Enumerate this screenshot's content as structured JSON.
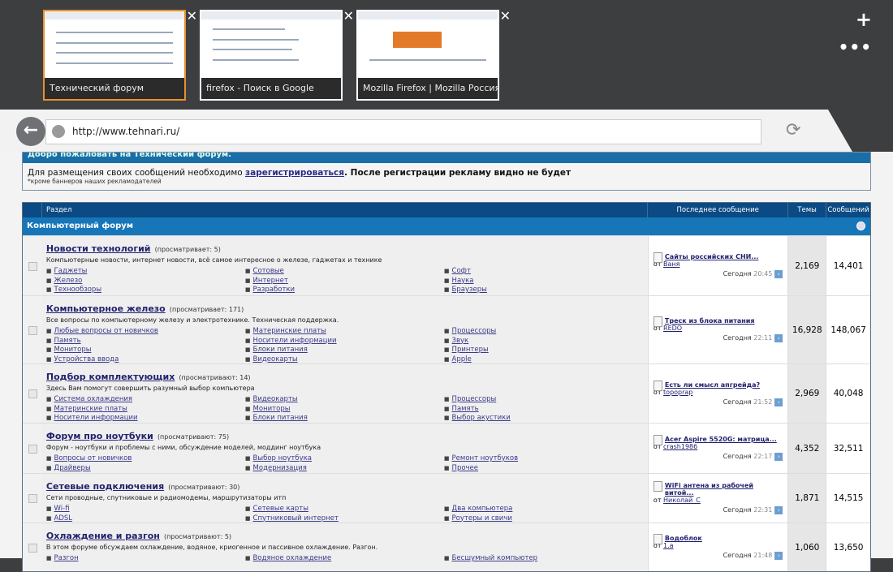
{
  "tabs": [
    {
      "label": "Технический форум",
      "active": true
    },
    {
      "label": "firefox - Поиск в Google"
    },
    {
      "label": "Mozilla Firefox | Mozilla Россия"
    }
  ],
  "browser": {
    "url": "http://www.tehnari.ru/",
    "new_tab": "+",
    "more": "•••"
  },
  "welcome": {
    "title": "Добро пожаловать на Технический форум.",
    "text_before": "Для размещения своих сообщений необходимо ",
    "register_link": "зарегистрироваться",
    "text_after": ". После регистрации рекламу видно не будет",
    "note": "*кроме баннеров наших рекламодателей"
  },
  "table": {
    "headers": {
      "section": "Раздел",
      "last": "Последнее сообщение",
      "topics": "Темы",
      "posts": "Сообщений"
    },
    "category": "Компьютерный форум"
  },
  "forums": [
    {
      "name": "Новости технологий",
      "views": "(просматривает: 5)",
      "desc": "Компьютерные новости, интернет новости, всё самое интересное о железе, гаджетах и технике",
      "subs": [
        "Гаджеты",
        "Сотовые",
        "Софт",
        "Железо",
        "Интернет",
        "Наука",
        "Технообзоры",
        "Разработки",
        "Браузеры"
      ],
      "last_title": "Сайты российских СНИ...",
      "by_prefix": "от",
      "last_by": "Ваня",
      "day": "Сегодня",
      "time": "20:45",
      "topics": "2,169",
      "posts": "14,401"
    },
    {
      "name": "Компьютерное железо",
      "views": "(просматривает: 171)",
      "desc": "Все вопросы по компьютерному железу и электротехнике. Техническая поддержка.",
      "subs": [
        "Любые вопросы от новичков",
        "Материнские платы",
        "Процессоры",
        "Память",
        "Носители информации",
        "Звук",
        "Мониторы",
        "Блоки питания",
        "Принтеры",
        "Устройства ввода",
        "Видеокарты",
        "Apple"
      ],
      "last_title": "Треск из блока питания",
      "by_prefix": "от",
      "last_by": "REDO",
      "day": "Сегодня",
      "time": "22:11",
      "topics": "16,928",
      "posts": "148,067"
    },
    {
      "name": "Подбор комплектующих",
      "views": "(просматривают: 14)",
      "desc": "Здесь Вам помогут совершить разумный выбор компьютера",
      "subs": [
        "Система охлаждения",
        "Видеокарты",
        "Процессоры",
        "Материнские платы",
        "Мониторы",
        "Память",
        "Носители информации",
        "Блоки питания",
        "Выбор акустики"
      ],
      "last_title": "Есть ли смысл апгрейда?",
      "by_prefix": "от",
      "last_by": "topoprap",
      "day": "Сегодня",
      "time": "21:52",
      "topics": "2,969",
      "posts": "40,048"
    },
    {
      "name": "Форум про ноутбуки",
      "views": "(просматривают: 75)",
      "desc": "Форум - ноутбуки и проблемы с ними, обсуждение моделей, моддинг ноутбука",
      "subs": [
        "Вопросы от новичков",
        "Выбор ноутбука",
        "Ремонт ноутбуков",
        "Драйверы",
        "Модернизация",
        "Прочее"
      ],
      "last_title": "Acer Aspire 5520G: матрица...",
      "by_prefix": "от",
      "last_by": "crash1986",
      "day": "Сегодня",
      "time": "22:17",
      "topics": "4,352",
      "posts": "32,511"
    },
    {
      "name": "Сетевые подключения",
      "views": "(просматривают: 30)",
      "desc": "Сети проводные, спутниковые и радиомодемы, маршрутизаторы итп",
      "subs": [
        "Wi-fi",
        "Сетевые карты",
        "Два компьютера",
        "ADSL",
        "Спутниковый интернет",
        "Роутеры и свичи"
      ],
      "last_title": "WiFi антена из рабочей витой...",
      "by_prefix": "от",
      "last_by": "Николай_С",
      "day": "Сегодня",
      "time": "22:31",
      "topics": "1,871",
      "posts": "14,515"
    },
    {
      "name": "Охлаждение и разгон",
      "views": "(просматривают: 5)",
      "desc": "В этом форуме обсуждаем охлаждение, водяное, криогенное и пассивное охлаждение. Разгон.",
      "subs": [
        "Разгон",
        "Водяное охлаждение",
        "Бесшумный компьютер"
      ],
      "last_title": "Водоблок",
      "by_prefix": "от",
      "last_by": "1.a",
      "day": "Сегодня",
      "time": "21:48",
      "topics": "1,060",
      "posts": "13,650"
    }
  ]
}
